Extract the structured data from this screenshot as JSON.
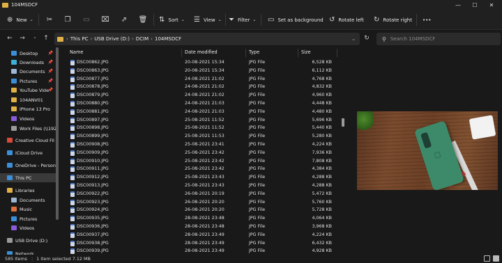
{
  "window": {
    "title": "104MSDCF",
    "controls": [
      "—",
      "☐",
      "✕"
    ]
  },
  "toolbar": {
    "new_label": "New",
    "sort_label": "Sort",
    "view_label": "View",
    "filter_label": "Filter",
    "set_bg_label": "Set as background",
    "rotate_left_label": "Rotate left",
    "rotate_right_label": "Rotate right",
    "more_label": "•••"
  },
  "address": {
    "crumbs": [
      "This PC",
      "USB Drive (D:)",
      "DCIM",
      "104MSDCF"
    ],
    "search_placeholder": "Search 104MSDCF"
  },
  "sidebar": {
    "items": [
      {
        "label": "Desktop",
        "pinned": true,
        "color": "#3b8fd9"
      },
      {
        "label": "Downloads",
        "pinned": true,
        "color": "#3bb0d9"
      },
      {
        "label": "Documents",
        "pinned": true,
        "color": "#9fb7d6"
      },
      {
        "label": "Pictures",
        "pinned": true,
        "color": "#3b8fd9"
      },
      {
        "label": "YouTube Vide",
        "pinned": true,
        "color": "#e0b146"
      },
      {
        "label": "104ANV01",
        "pinned": false,
        "color": "#e0b146"
      },
      {
        "label": "iPhone 13 Pro",
        "pinned": false,
        "color": "#e0b146"
      },
      {
        "label": "Videos",
        "pinned": false,
        "color": "#8a5ad9"
      },
      {
        "label": "Work Files (\\\\192",
        "pinned": false,
        "color": "#9a9a9a"
      },
      {
        "label": "Creative Cloud Fil",
        "pinned": false,
        "color": "#d94a3b"
      },
      {
        "label": "iCloud Drive",
        "pinned": false,
        "color": "#3b8fd9"
      },
      {
        "label": "OneDrive - Person",
        "pinned": false,
        "color": "#3b8fd9"
      },
      {
        "label": "This PC",
        "pinned": false,
        "color": "#3b8fd9"
      },
      {
        "label": "Libraries",
        "pinned": false,
        "color": "#e0b146"
      },
      {
        "label": "Documents",
        "pinned": false,
        "color": "#9fb7d6"
      },
      {
        "label": "Music",
        "pinned": false,
        "color": "#e0703b"
      },
      {
        "label": "Pictures",
        "pinned": false,
        "color": "#3b8fd9"
      },
      {
        "label": "Videos",
        "pinned": false,
        "color": "#8a5ad9"
      },
      {
        "label": "USB Drive (D:)",
        "pinned": false,
        "color": "#9a9a9a"
      },
      {
        "label": "Network",
        "pinned": false,
        "color": "#3b8fd9"
      }
    ],
    "pin_glyph": "📌"
  },
  "columns": {
    "name": "Name",
    "date": "Date modified",
    "type": "Type",
    "size": "Size"
  },
  "files": [
    {
      "name": "DSC00862.JPG",
      "date": "20-08-2021 15:34",
      "type": "JPG File",
      "size": "6,528 KB"
    },
    {
      "name": "DSC00863.JPG",
      "date": "20-08-2021 15:34",
      "type": "JPG File",
      "size": "6,112 KB"
    },
    {
      "name": "DSC00877.JPG",
      "date": "24-08-2021 21:02",
      "type": "JPG File",
      "size": "4,768 KB"
    },
    {
      "name": "DSC00878.JPG",
      "date": "24-08-2021 21:02",
      "type": "JPG File",
      "size": "4,832 KB"
    },
    {
      "name": "DSC00879.JPG",
      "date": "24-08-2021 21:02",
      "type": "JPG File",
      "size": "4,960 KB"
    },
    {
      "name": "DSC00880.JPG",
      "date": "24-08-2021 21:03",
      "type": "JPG File",
      "size": "4,448 KB"
    },
    {
      "name": "DSC00881.JPG",
      "date": "24-08-2021 21:03",
      "type": "JPG File",
      "size": "4,480 KB"
    },
    {
      "name": "DSC00897.JPG",
      "date": "25-08-2021 11:52",
      "type": "JPG File",
      "size": "5,696 KB"
    },
    {
      "name": "DSC00898.JPG",
      "date": "25-08-2021 11:52",
      "type": "JPG File",
      "size": "5,440 KB"
    },
    {
      "name": "DSC00899.JPG",
      "date": "25-08-2021 11:53",
      "type": "JPG File",
      "size": "5,280 KB"
    },
    {
      "name": "DSC00908.JPG",
      "date": "25-08-2021 23:41",
      "type": "JPG File",
      "size": "4,224 KB"
    },
    {
      "name": "DSC00909.JPG",
      "date": "25-08-2021 23:42",
      "type": "JPG File",
      "size": "7,936 KB"
    },
    {
      "name": "DSC00910.JPG",
      "date": "25-08-2021 23:42",
      "type": "JPG File",
      "size": "7,808 KB"
    },
    {
      "name": "DSC00911.JPG",
      "date": "25-08-2021 23:42",
      "type": "JPG File",
      "size": "4,384 KB"
    },
    {
      "name": "DSC00912.JPG",
      "date": "25-08-2021 23:43",
      "type": "JPG File",
      "size": "4,288 KB"
    },
    {
      "name": "DSC00913.JPG",
      "date": "25-08-2021 23:43",
      "type": "JPG File",
      "size": "4,288 KB"
    },
    {
      "name": "DSC00922.JPG",
      "date": "26-08-2021 20:19",
      "type": "JPG File",
      "size": "5,472 KB"
    },
    {
      "name": "DSC00923.JPG",
      "date": "26-08-2021 20:20",
      "type": "JPG File",
      "size": "5,760 KB"
    },
    {
      "name": "DSC00924.JPG",
      "date": "26-08-2021 20:20",
      "type": "JPG File",
      "size": "5,728 KB"
    },
    {
      "name": "DSC00935.JPG",
      "date": "28-08-2021 23:48",
      "type": "JPG File",
      "size": "4,064 KB"
    },
    {
      "name": "DSC00936.JPG",
      "date": "28-08-2021 23:48",
      "type": "JPG File",
      "size": "3,968 KB"
    },
    {
      "name": "DSC00937.JPG",
      "date": "28-08-2021 23:49",
      "type": "JPG File",
      "size": "4,224 KB"
    },
    {
      "name": "DSC00938.JPG",
      "date": "28-08-2021 23:49",
      "type": "JPG File",
      "size": "6,432 KB"
    },
    {
      "name": "DSC00939.JPG",
      "date": "28-08-2021 23:49",
      "type": "JPG File",
      "size": "4,928 KB"
    }
  ],
  "status": {
    "count": "585 items",
    "selected": "1 item selected  7.12 MB"
  }
}
